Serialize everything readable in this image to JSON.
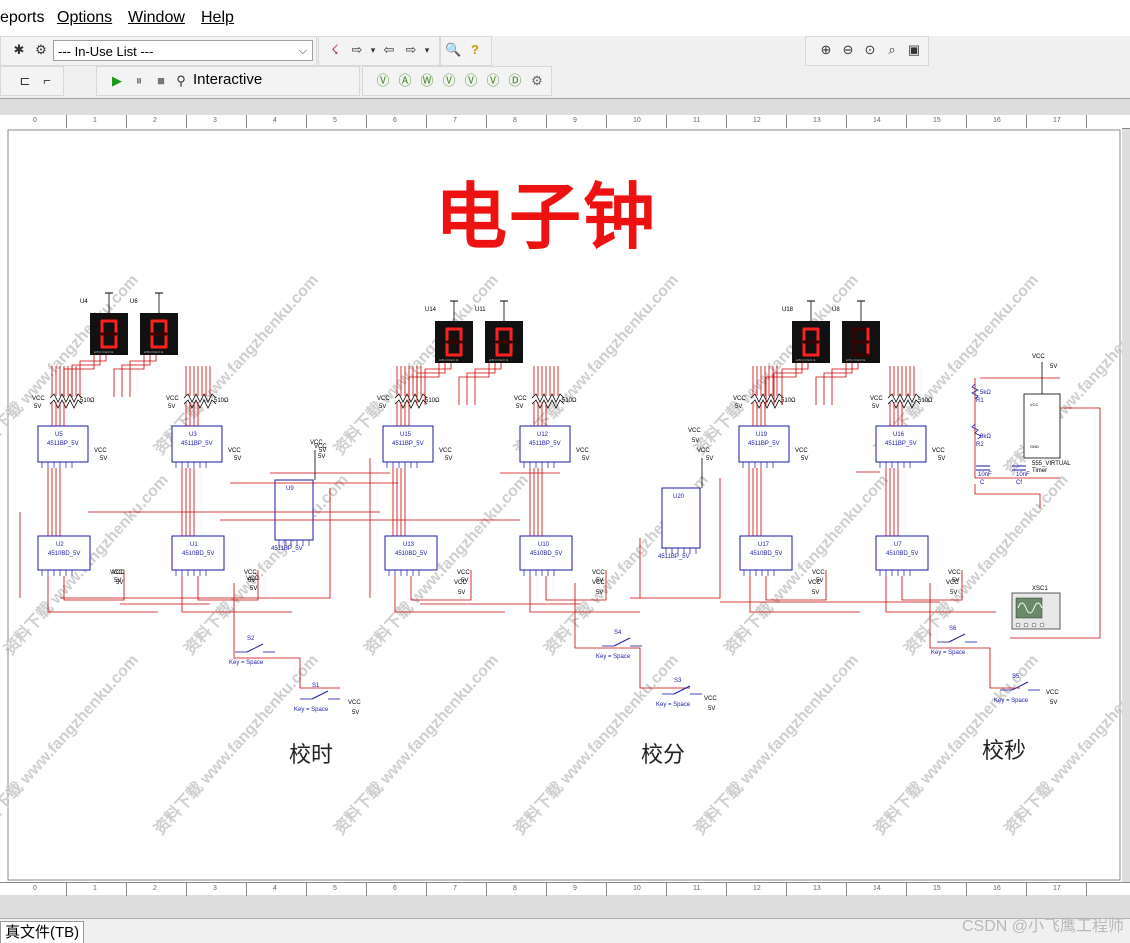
{
  "menu": {
    "items": [
      "eports",
      "Options",
      "Window",
      "Help"
    ]
  },
  "toolbar": {
    "in_use_list": "--- In-Use List ---",
    "interactive_label": "Interactive"
  },
  "schematic": {
    "title": "电子钟",
    "section_labels": [
      "校时",
      "校分",
      "校秒"
    ],
    "displays": [
      {
        "ref": "U4",
        "digit": "0"
      },
      {
        "ref": "U6",
        "digit": "0"
      },
      {
        "ref": "U14",
        "digit": "0"
      },
      {
        "ref": "U11",
        "digit": "0"
      },
      {
        "ref": "U18",
        "digit": "0"
      },
      {
        "ref": "U8",
        "digit": "1"
      }
    ],
    "decoder_chips": [
      {
        "ref": "U5",
        "part": "4511BP_5V"
      },
      {
        "ref": "U3",
        "part": "4511BP_5V"
      },
      {
        "ref": "U15",
        "part": "4511BP_5V"
      },
      {
        "ref": "U12",
        "part": "4511BP_5V"
      },
      {
        "ref": "U19",
        "part": "4511BP_5V"
      },
      {
        "ref": "U16",
        "part": "4511BP_5V"
      }
    ],
    "counter_chips": [
      {
        "ref": "U2",
        "part": "4510BD_5V"
      },
      {
        "ref": "U1",
        "part": "4510BD_5V"
      },
      {
        "ref": "U13",
        "part": "4510BD_5V"
      },
      {
        "ref": "U10",
        "part": "4510BD_5V"
      },
      {
        "ref": "U17",
        "part": "4510BD_5V"
      },
      {
        "ref": "U7",
        "part": "4510BD_5V"
      }
    ],
    "misc_chips": [
      {
        "ref": "U9",
        "part": "4511BP_5V"
      },
      {
        "ref": "U20",
        "part": "4511BP_5V"
      }
    ],
    "switches": [
      {
        "ref": "S2",
        "key": "Key = Space"
      },
      {
        "ref": "S1",
        "key": "Key = Space"
      },
      {
        "ref": "S4",
        "key": "Key = Space"
      },
      {
        "ref": "S3",
        "key": "Key = Space"
      },
      {
        "ref": "S6",
        "key": "Key = Space"
      },
      {
        "ref": "S5",
        "key": "Key = Space"
      }
    ],
    "timer": {
      "label": "555_VIRTUAL",
      "sub": "Timer",
      "r1": "5kΩ",
      "r1ref": "R1",
      "r2": "8kΩ",
      "r2ref": "R2",
      "c": "10nF",
      "cref": "C",
      "cf": "10nF",
      "cfref": "Cf"
    },
    "scope": {
      "ref": "XSC1"
    },
    "power": {
      "vcc": "VCC",
      "volt": "5V"
    },
    "resistor_value": "510Ω",
    "watermark": "资料下载 www.fangzhenku.com"
  },
  "ruler": {
    "numbers": [
      "0",
      "1",
      "2",
      "3",
      "4",
      "5",
      "6",
      "7",
      "8",
      "9",
      "10",
      "11",
      "12",
      "13",
      "14",
      "15",
      "16",
      "17"
    ]
  },
  "status": {
    "tab_label": "真文件(TB)",
    "credit": "CSDN @小飞鹰工程师"
  },
  "colors": {
    "title_red": "#ee1111",
    "wire_red": "#cc0000",
    "component_blue": "#1a1aaa",
    "display_bg": "#111111",
    "segment_red": "#ff2020"
  }
}
